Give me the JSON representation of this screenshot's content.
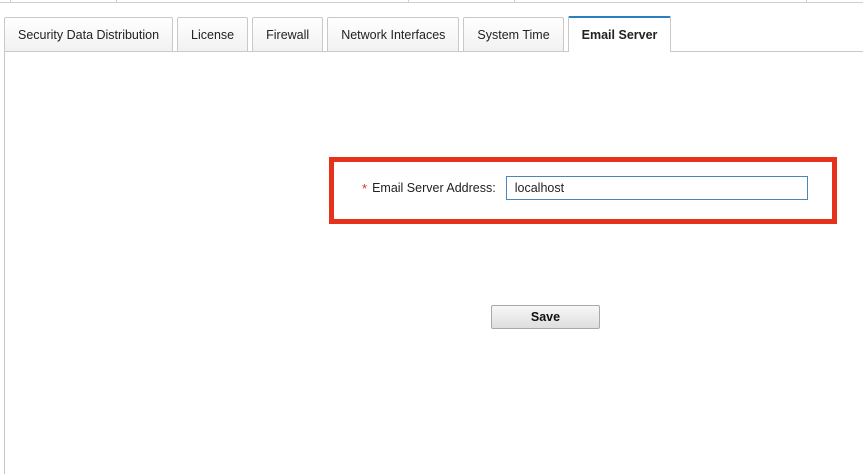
{
  "tabs": [
    {
      "label": "Security Data Distribution",
      "active": false
    },
    {
      "label": "License",
      "active": false
    },
    {
      "label": "Firewall",
      "active": false
    },
    {
      "label": "Network Interfaces",
      "active": false
    },
    {
      "label": "System Time",
      "active": false
    },
    {
      "label": "Email Server",
      "active": true
    }
  ],
  "form": {
    "required_marker": "*",
    "email_server_label": "Email Server Address:",
    "email_server_value": "localhost",
    "save_label": "Save"
  },
  "colors": {
    "accent": "#2a7fbf",
    "highlight": "#e8311a",
    "required": "#d9331f"
  }
}
